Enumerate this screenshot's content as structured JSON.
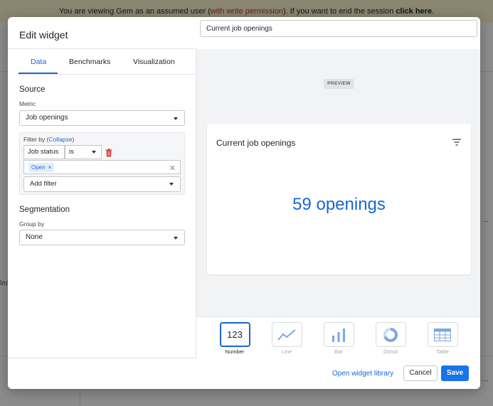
{
  "banner": {
    "prefix": "You are viewing Gem as an assumed user (",
    "warning": "with write permission",
    "middle": "). If you want to end the session ",
    "link": "click here",
    "suffix": "."
  },
  "background": {
    "frag_left": "lea",
    "frag_dots": "..."
  },
  "modal": {
    "title": "Edit widget",
    "tabs": [
      "Data",
      "Benchmarks",
      "Visualization"
    ],
    "active_tab": "Data",
    "source": {
      "heading": "Source",
      "metric_label": "Metric",
      "metric_value": "Job openings"
    },
    "filter": {
      "label": "Filter by (",
      "collapse": "Collapse",
      "label_end": ")",
      "field": "Job status",
      "operator": "is",
      "chip": "Open",
      "chip_remove": "×",
      "clear": "✕",
      "add_filter": "Add filter"
    },
    "segmentation": {
      "heading": "Segmentation",
      "group_label": "Group by",
      "group_value": "None"
    },
    "widget_title_value": "Current job openings",
    "preview": {
      "badge": "PREVIEW",
      "card_title": "Current job openings",
      "big_number": "59 openings"
    },
    "visualizations": [
      {
        "label": "Number",
        "icon": "number-icon",
        "glyph": "123",
        "active": true
      },
      {
        "label": "Line",
        "icon": "line-chart-icon",
        "active": false
      },
      {
        "label": "Bar",
        "icon": "bar-chart-icon",
        "active": false
      },
      {
        "label": "Donut",
        "icon": "donut-chart-icon",
        "active": false
      },
      {
        "label": "Table",
        "icon": "table-icon",
        "active": false
      }
    ],
    "footer": {
      "library_link": "Open widget library",
      "cancel": "Cancel",
      "save": "Save"
    }
  },
  "colors": {
    "accent": "#1a73e8",
    "link": "#1967d2",
    "warning": "#c0392b",
    "trash": "#d93025",
    "banner_bg": "#fbf5cf"
  }
}
